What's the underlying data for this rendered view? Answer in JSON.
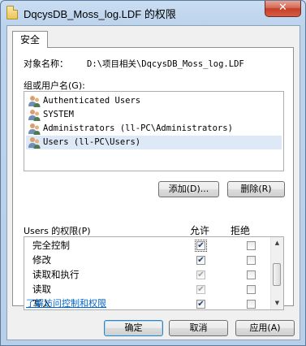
{
  "window": {
    "title": "DqcysDB_Moss_log.LDF 的权限",
    "close_glyph": "✕"
  },
  "tabs": [
    {
      "label": "安全"
    }
  ],
  "object": {
    "label": "对象名称：",
    "value": "D:\\项目相关\\DqcysDB_Moss_log.LDF"
  },
  "groups": {
    "label": "组或用户名(G):",
    "items": [
      {
        "name": "Authenticated Users",
        "icon": "users-icon"
      },
      {
        "name": "SYSTEM",
        "icon": "users-icon"
      },
      {
        "name": "Administrators (ll-PC\\Administrators)",
        "icon": "users-icon"
      },
      {
        "name": "Users (ll-PC\\Users)",
        "icon": "users-icon",
        "selected": true
      }
    ],
    "add_button": "添加(D)...",
    "remove_button": "删除(R)"
  },
  "permissions": {
    "label": "Users 的权限(P)",
    "allow_header": "允许",
    "deny_header": "拒绝",
    "rows": [
      {
        "name": "完全控制",
        "allow": true,
        "allow_disabled": false,
        "deny": false
      },
      {
        "name": "修改",
        "allow": true,
        "allow_disabled": false,
        "deny": false
      },
      {
        "name": "读取和执行",
        "allow": true,
        "allow_disabled": true,
        "deny": false
      },
      {
        "name": "读取",
        "allow": true,
        "allow_disabled": true,
        "deny": false
      },
      {
        "name": "写入",
        "allow": true,
        "allow_disabled": false,
        "deny": false
      }
    ]
  },
  "link": "了解访问控制和权限",
  "buttons": {
    "ok": "确定",
    "cancel": "取消",
    "apply": "应用(A)"
  }
}
